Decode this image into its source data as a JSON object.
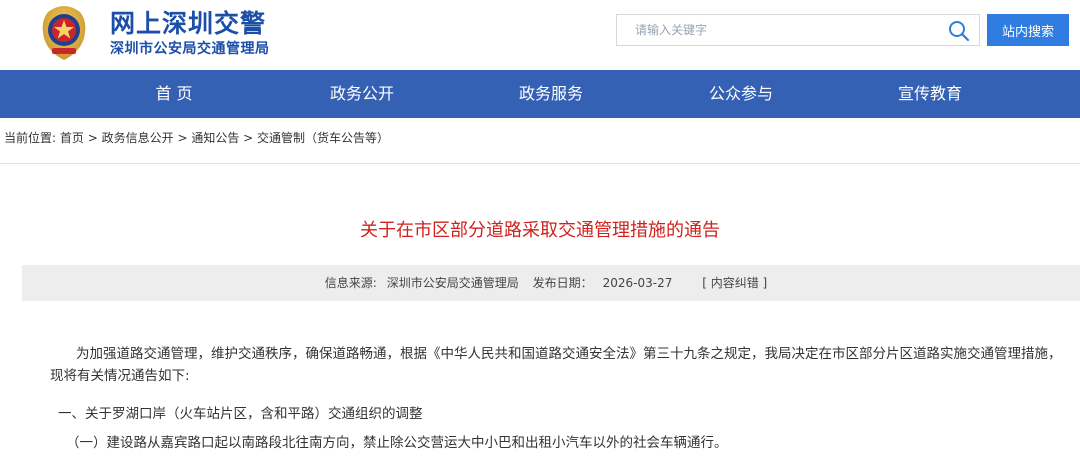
{
  "header": {
    "brand_title": "网上深圳交警",
    "brand_subtitle": "深圳市公安局交通管理局",
    "emblem_icon": "police-emblem-icon",
    "search_placeholder": "请输入关键字",
    "search_button_label": "站内搜索",
    "search_icon": "search-icon"
  },
  "nav": {
    "items": [
      "首 页",
      "政务公开",
      "政务服务",
      "公众参与",
      "宣传教育"
    ]
  },
  "breadcrumb": {
    "label": "当前位置:",
    "items": [
      "首页",
      "政务信息公开",
      "通知公告",
      "交通管制（货车公告等）"
    ],
    "separator": ">"
  },
  "article": {
    "title": "关于在市区部分道路采取交通管理措施的通告",
    "source_label": "信息来源:",
    "source_value": "深圳市公安局交通管理局",
    "date_label": "发布日期：",
    "date_value": "2026-03-27",
    "correction_label": "[ 内容纠错 ]",
    "paragraphs": [
      "为加强道路交通管理，维护交通秩序，确保道路畅通，根据《中华人民共和国道路交通安全法》第三十九条之规定，我局决定在市区部分片区道路实施交通管理措施，现将有关情况通告如下:",
      "一、关于罗湖口岸（火车站片区，含和平路）交通组织的调整",
      "（一）建设路从嘉宾路口起以南路段北往南方向，禁止除公交营运大中小巴和出租小汽车以外的社会车辆通行。"
    ]
  },
  "colors": {
    "brand_blue": "#1d4fa8",
    "nav_blue": "#3561b4",
    "button_blue": "#2f7de1",
    "title_red": "#d0221e"
  }
}
